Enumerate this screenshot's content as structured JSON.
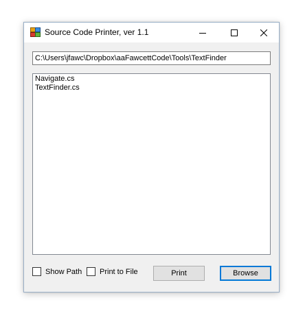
{
  "window": {
    "title": "Source Code Printer, ver 1.1"
  },
  "path_field": {
    "value": "C:\\Users\\jfawc\\Dropbox\\aaFawcettCode\\Tools\\TextFinder"
  },
  "file_list": {
    "items": [
      "Navigate.cs",
      "TextFinder.cs"
    ]
  },
  "options": {
    "show_path_label": "Show Path",
    "show_path_checked": false,
    "print_to_file_label": "Print to File",
    "print_to_file_checked": false
  },
  "buttons": {
    "print_label": "Print",
    "browse_label": "Browse"
  },
  "icons": {
    "app": "app-icon",
    "minimize": "minimize-icon",
    "maximize": "maximize-icon",
    "close": "close-icon"
  },
  "colors": {
    "accent": "#0078d7",
    "window_bg": "#f0f0f0"
  }
}
